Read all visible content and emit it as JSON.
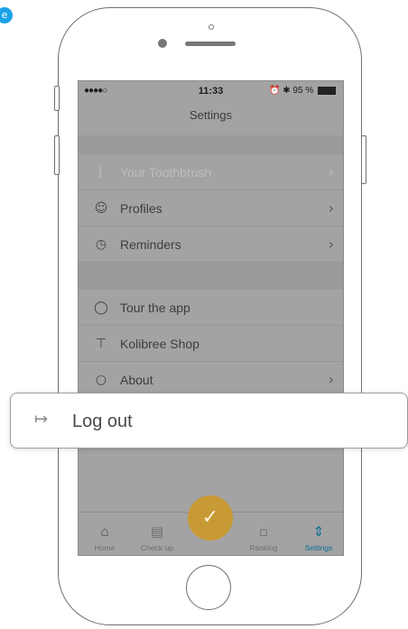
{
  "corner_badge": "e",
  "status_bar": {
    "signal": "●●●●○",
    "time": "11:33",
    "battery": "95 %",
    "alarm_icon": "alarm-icon",
    "bluetooth_icon": "bluetooth-icon"
  },
  "nav": {
    "title": "Settings"
  },
  "settings_rows": [
    {
      "label": "Your Toothbrush",
      "icon": "toothbrush-icon",
      "chevron": true,
      "disabled": true
    },
    {
      "label": "Profiles",
      "icon": "person-icon",
      "chevron": true,
      "disabled": false
    },
    {
      "label": "Reminders",
      "icon": "alarm-clock-icon",
      "chevron": true,
      "disabled": false
    },
    {
      "label": "Tour the app",
      "icon": "tour-icon",
      "chevron": false,
      "disabled": false
    },
    {
      "label": "Kolibree Shop",
      "icon": "cart-icon",
      "chevron": false,
      "disabled": false
    },
    {
      "label": "About",
      "icon": "chat-bubble-icon",
      "chevron": true,
      "disabled": false
    }
  ],
  "tabbar": {
    "tabs": [
      {
        "label": "Home",
        "icon": "home-icon",
        "active": false
      },
      {
        "label": "Check up",
        "icon": "clipboard-icon",
        "active": false
      },
      {
        "label": "Ranking",
        "icon": "podium-icon",
        "active": false
      },
      {
        "label": "Settings",
        "icon": "sliders-icon",
        "active": true
      }
    ],
    "center_button_icon": "toothbrush-icon"
  },
  "highlight": {
    "label": "Log out",
    "icon": "logout-icon"
  },
  "colors": {
    "accent_active": "#0f6f9a",
    "fab": "#c79a35",
    "badge": "#1aa3e8"
  }
}
